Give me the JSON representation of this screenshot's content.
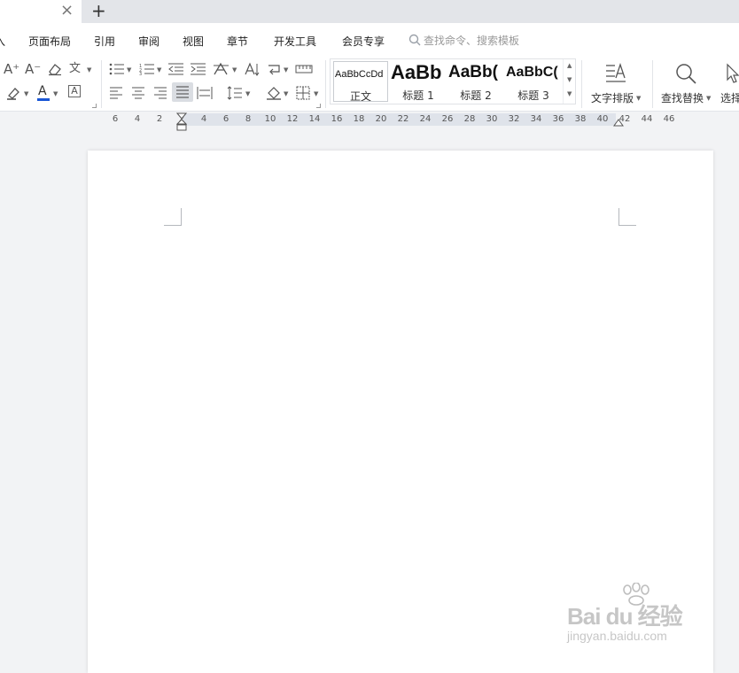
{
  "tabbar": {
    "close_symbol": "×",
    "new_tab_symbol": "+"
  },
  "menu": {
    "items": [
      "入",
      "页面布局",
      "引用",
      "审阅",
      "视图",
      "章节",
      "开发工具",
      "会员专享"
    ],
    "search_placeholder": "查找命令、搜索模板"
  },
  "ribbon": {
    "font_grow": "A⁺",
    "font_shrink": "A⁻",
    "pinyin": "文",
    "font_color_letter": "A",
    "char_border_letter": "A",
    "styles": {
      "items": [
        {
          "sample": "AaBbCcDd",
          "label": "正文"
        },
        {
          "sample": "AaBb",
          "label": "标题 1"
        },
        {
          "sample": "AaBb(",
          "label": "标题 2"
        },
        {
          "sample": "AaBbC(",
          "label": "标题 3"
        }
      ]
    },
    "text_layout_label": "文字排版",
    "find_replace_label": "查找替换",
    "select_label": "选择"
  },
  "ruler": {
    "ticks": [
      "6",
      "4",
      "2",
      "2",
      "4",
      "6",
      "8",
      "10",
      "12",
      "14",
      "16",
      "18",
      "20",
      "22",
      "24",
      "26",
      "28",
      "30",
      "32",
      "34",
      "36",
      "38",
      "40",
      "42",
      "44",
      "46"
    ]
  },
  "colors": {
    "accent": "#1a57d6",
    "ruler_band": "#dfe3ea",
    "tabbar": "#e3e5e9"
  },
  "watermark": {
    "brand": "Bai du 经验",
    "url": "jingyan.baidu.com"
  }
}
